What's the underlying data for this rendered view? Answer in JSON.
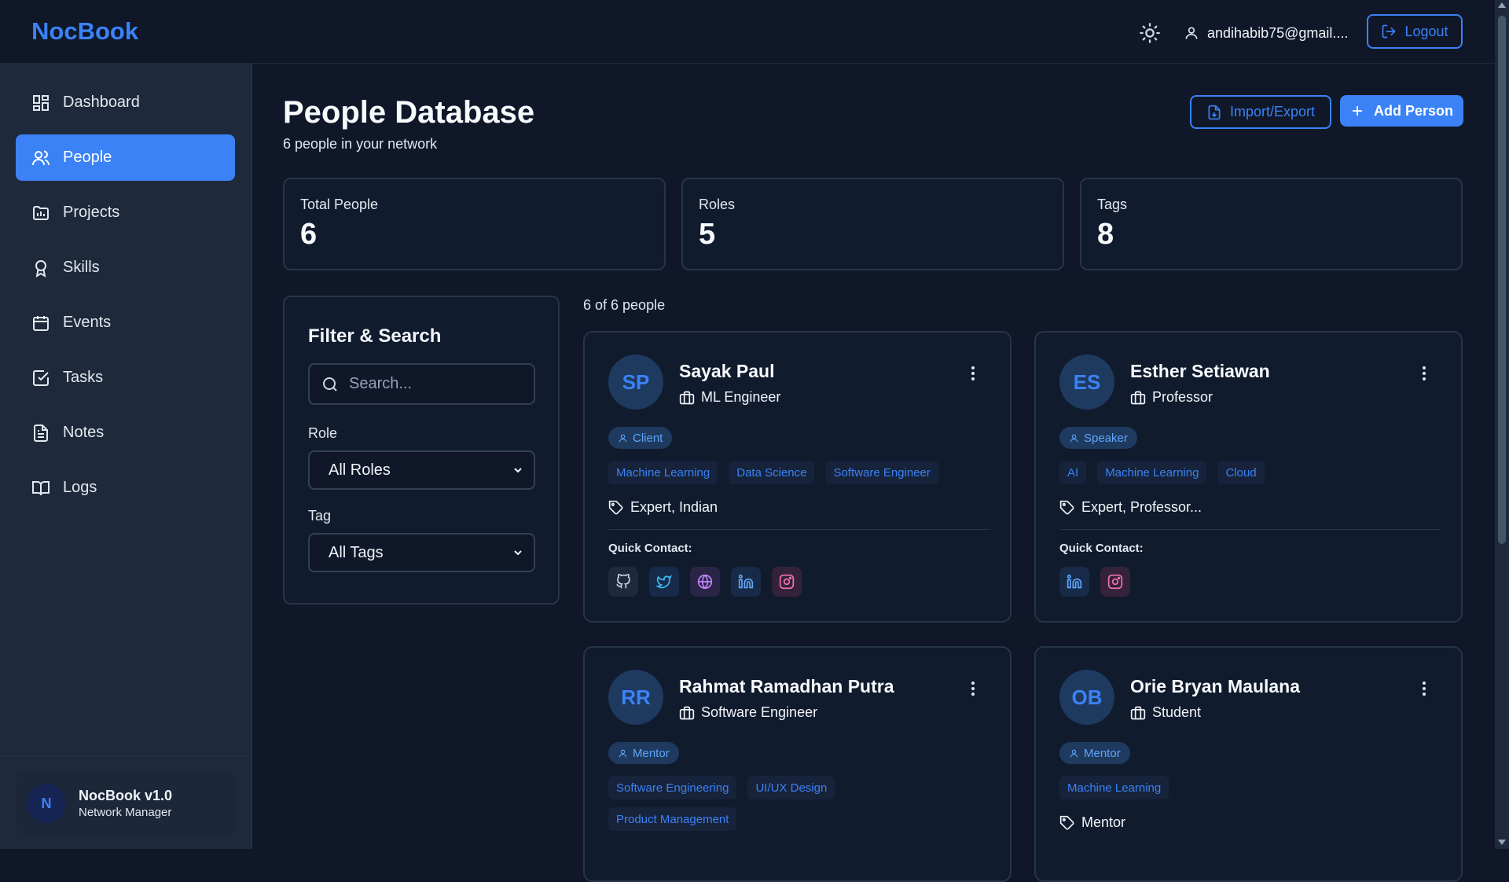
{
  "app": {
    "name": "NocBook"
  },
  "header": {
    "user_email": "andihabib75@gmail....",
    "logout_label": "Logout",
    "theme_icon": "sun-icon"
  },
  "sidebar": {
    "items": [
      {
        "label": "Dashboard",
        "icon": "dashboard-icon"
      },
      {
        "label": "People",
        "icon": "people-icon",
        "active": true
      },
      {
        "label": "Projects",
        "icon": "projects-icon"
      },
      {
        "label": "Skills",
        "icon": "award-icon"
      },
      {
        "label": "Events",
        "icon": "calendar-icon"
      },
      {
        "label": "Tasks",
        "icon": "check-square-icon"
      },
      {
        "label": "Notes",
        "icon": "file-text-icon"
      },
      {
        "label": "Logs",
        "icon": "book-open-icon"
      }
    ],
    "footer": {
      "avatar_letter": "N",
      "title": "NocBook v1.0",
      "subtitle": "Network Manager"
    }
  },
  "main": {
    "title": "People Database",
    "subtitle": "6 people in your network",
    "import_export_label": "Import/Export",
    "add_person_label": "Add Person",
    "stats": [
      {
        "label": "Total People",
        "value": "6"
      },
      {
        "label": "Roles",
        "value": "5"
      },
      {
        "label": "Tags",
        "value": "8"
      }
    ],
    "filter": {
      "title": "Filter & Search",
      "search_placeholder": "Search...",
      "role_label": "Role",
      "role_value": "All Roles",
      "tag_label": "Tag",
      "tag_value": "All Tags"
    },
    "result_count": "6 of 6 people",
    "quick_contact_label": "Quick Contact:",
    "people": [
      {
        "initials": "SP",
        "name": "Sayak Paul",
        "title": "ML Engineer",
        "role": "Client",
        "skills": [
          "Machine Learning",
          "Data Science",
          "Software Engineer"
        ],
        "tags": "Expert, Indian",
        "contacts": [
          "github-icon",
          "twitter-icon",
          "globe-icon",
          "linkedin-icon",
          "instagram-icon"
        ]
      },
      {
        "initials": "ES",
        "name": "Esther Setiawan",
        "title": "Professor",
        "role": "Speaker",
        "skills": [
          "AI",
          "Machine Learning",
          "Cloud"
        ],
        "tags": "Expert, Professor...",
        "contacts": [
          "linkedin-icon",
          "instagram-icon"
        ]
      },
      {
        "initials": "RR",
        "name": "Rahmat Ramadhan Putra",
        "title": "Software Engineer",
        "role": "Mentor",
        "skills": [
          "Software Engineering",
          "UI/UX Design",
          "Product Management"
        ],
        "tags": ""
      },
      {
        "initials": "OB",
        "name": "Orie Bryan Maulana",
        "title": "Student",
        "role": "Mentor",
        "skills": [
          "Machine Learning"
        ],
        "tags": "Mentor"
      }
    ]
  },
  "colors": {
    "accent": "#3b82f6",
    "background": "#0f1729",
    "sidebar": "#1e293b",
    "card": "#111b2e"
  }
}
